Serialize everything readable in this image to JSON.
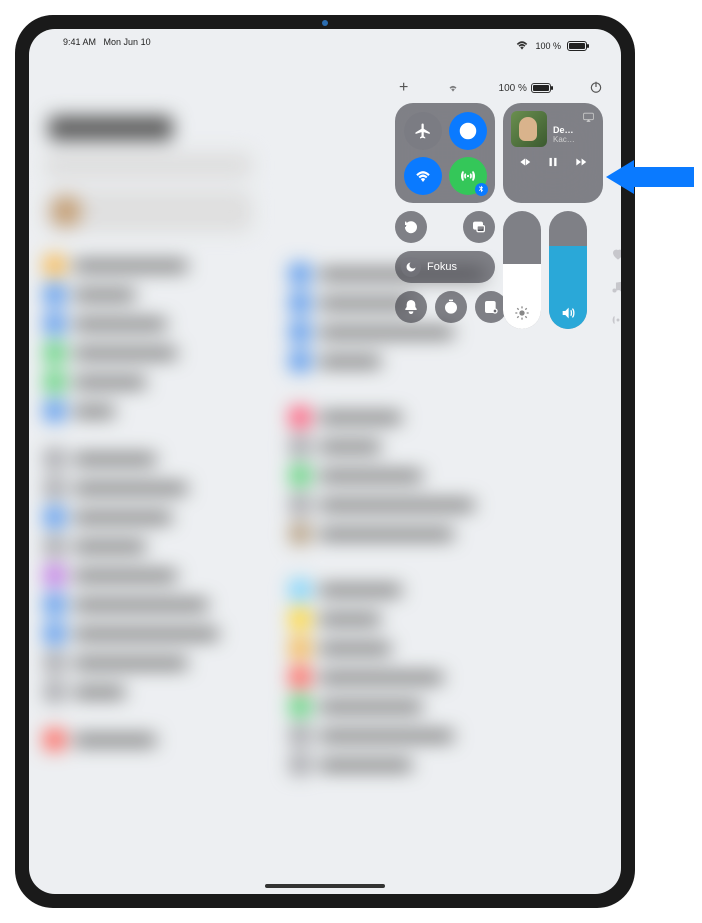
{
  "status": {
    "time": "9:41 AM",
    "date": "Mon Jun 10",
    "battery_pct": "100 %"
  },
  "cc": {
    "focus_label": "Fokus",
    "media": {
      "title": "Deeper Well",
      "artist": "Kacey Musgrave"
    },
    "brightness_pct": 55,
    "volume_pct": 70
  },
  "bg_title": "Settings"
}
